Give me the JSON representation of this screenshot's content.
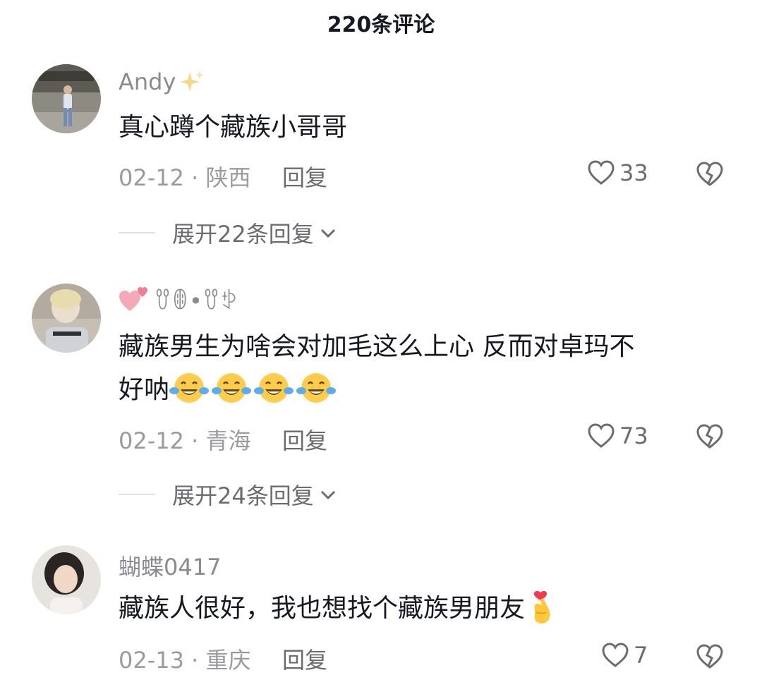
{
  "header": {
    "title": "220条评论"
  },
  "comments": [
    {
      "username": "Andy",
      "username_decoration": "sparkle",
      "text": "真心蹲个藏族小哥哥",
      "date": "02-12",
      "location": "陕西",
      "reply_label": "回复",
      "likes": "33",
      "expand_label": "展开22条回复"
    },
    {
      "username": "ꀎꂦ•ꀎꉣ",
      "username_prefix": "heart",
      "text_part1": "藏族男生为啥会对加毛这么上心  反而对卓玛不",
      "text_part2": "好呐",
      "emoji": "laughing-crying",
      "date": "02-12",
      "location": "青海",
      "reply_label": "回复",
      "likes": "73",
      "expand_label": "展开24条回复"
    },
    {
      "username": "蝴蝶0417",
      "text": "藏族人很好，我也想找个藏族男朋友",
      "emoji": "finger-heart",
      "date": "02-13",
      "location": "重庆",
      "reply_label": "回复",
      "likes": "7"
    }
  ],
  "colors": {
    "text": "#161823",
    "muted": "#8a8b91",
    "meta": "#9a9ba1",
    "action": "#6b6c72"
  }
}
